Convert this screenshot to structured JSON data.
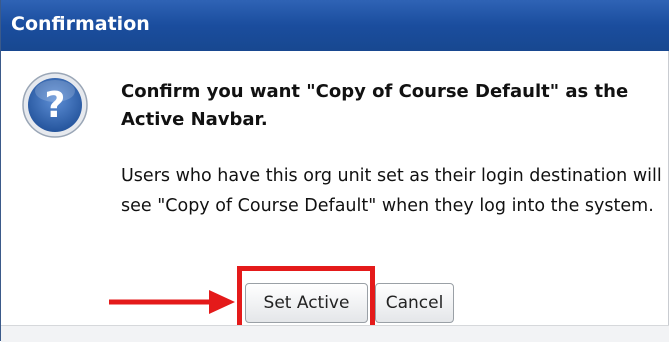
{
  "dialog": {
    "title": "Confirmation",
    "heading": "Confirm you want \"Copy of Course Default\" as the Active Navbar.",
    "message": "Users who have this org unit set as their login destination will see \"Copy of Course Default\" when they log into the system.",
    "icon": "question-icon"
  },
  "buttons": {
    "set_active_label": "Set Active",
    "cancel_label": "Cancel"
  },
  "annotation": {
    "highlight_color": "#e41a1a",
    "arrow_color": "#e41a1a"
  },
  "colors": {
    "titlebar": "#1a4d9e",
    "icon_blue": "#2c64b0"
  }
}
